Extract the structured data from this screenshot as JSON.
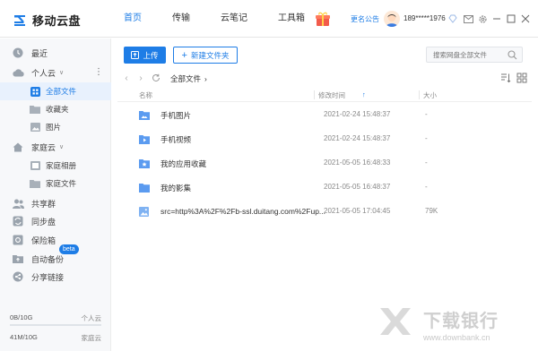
{
  "app": {
    "name": "移动云盘"
  },
  "nav": {
    "items": [
      "首页",
      "传输",
      "云笔记",
      "工具箱"
    ],
    "active_index": 0
  },
  "header": {
    "announcement": "更名公告",
    "username": "189*****1976"
  },
  "sidebar": {
    "recent": "最近",
    "personal_cloud": "个人云",
    "personal_items": [
      "全部文件",
      "收藏夹",
      "图片"
    ],
    "family_cloud": "家庭云",
    "family_items": [
      "家庭相册",
      "家庭文件"
    ],
    "shared_group": "共享群",
    "sync_disk": "同步盘",
    "safe_box": "保险箱",
    "auto_backup": "自动备份",
    "beta_badge": "beta",
    "share_links": "分享链接",
    "usage": [
      {
        "used": "0B/10G",
        "label": "个人云",
        "fraction": 0
      },
      {
        "used": "41M/10G",
        "label": "家庭云",
        "fraction": 0.004
      }
    ]
  },
  "toolbar": {
    "upload": "上传",
    "new_folder": "新建文件夹",
    "search_placeholder": "搜索网盘全部文件"
  },
  "breadcrumb": {
    "path": "全部文件"
  },
  "table": {
    "columns": {
      "name": "名称",
      "modified": "修改时间",
      "size": "大小"
    },
    "rows": [
      {
        "name": "手机图片",
        "modified": "2021-02-24 15:48:37",
        "size": "-",
        "icon": "folder-image-icon"
      },
      {
        "name": "手机视频",
        "modified": "2021-02-24 15:48:37",
        "size": "-",
        "icon": "folder-video-icon"
      },
      {
        "name": "我的应用收藏",
        "modified": "2021-05-05 16:48:33",
        "size": "-",
        "icon": "folder-star-icon"
      },
      {
        "name": "我的影集",
        "modified": "2021-05-05 16:48:37",
        "size": "-",
        "icon": "folder-icon"
      },
      {
        "name": "src=http%3A%2F%2Fb-ssl.duitang.com%2Fup...",
        "modified": "2021-05-05 17:04:45",
        "size": "79K",
        "icon": "image-file-icon"
      }
    ]
  },
  "watermark": {
    "text": "下载银行",
    "url": "www.downbank.cn"
  },
  "colors": {
    "accent": "#1e7de6",
    "sidebar_bg": "#f7f8fa",
    "active_bg": "#e8f1fd"
  }
}
